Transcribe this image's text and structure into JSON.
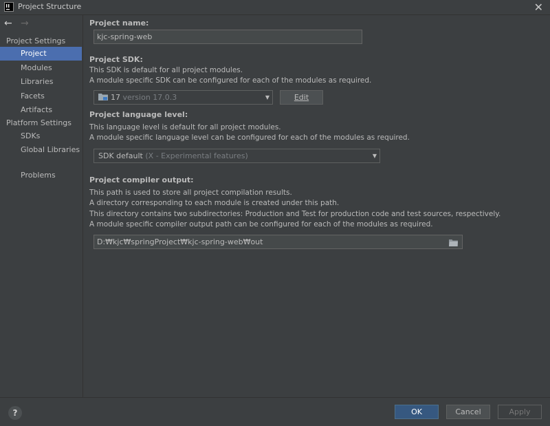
{
  "window": {
    "title": "Project Structure",
    "close_glyph": "✕"
  },
  "nav": {
    "back_glyph": "←",
    "forward_glyph": "→"
  },
  "sidebar": {
    "project_settings_header": "Project Settings",
    "project_settings_items": [
      {
        "label": "Project",
        "selected": true
      },
      {
        "label": "Modules"
      },
      {
        "label": "Libraries"
      },
      {
        "label": "Facets"
      },
      {
        "label": "Artifacts"
      }
    ],
    "platform_settings_header": "Platform Settings",
    "platform_settings_items": [
      {
        "label": "SDKs"
      },
      {
        "label": "Global Libraries"
      }
    ],
    "problems_label": "Problems"
  },
  "project": {
    "name_label": "Project name:",
    "name_value": "kjc-spring-web",
    "sdk_label": "Project SDK:",
    "sdk_desc_1": "This SDK is default for all project modules.",
    "sdk_desc_2": "A module specific SDK can be configured for each of the modules as required.",
    "sdk_value_main": "17",
    "sdk_value_dim": "version 17.0.3",
    "edit_button": "Edit",
    "lang_label": "Project language level:",
    "lang_desc_1": "This language level is default for all project modules.",
    "lang_desc_2": "A module specific language level can be configured for each of the modules as required.",
    "lang_value_main": "SDK default",
    "lang_value_dim": "(X - Experimental features)",
    "output_label": "Project compiler output:",
    "output_desc_1": "This path is used to store all project compilation results.",
    "output_desc_2": "A directory corresponding to each module is created under this path.",
    "output_desc_3": "This directory contains two subdirectories: Production and Test for production code and test sources, respectively.",
    "output_desc_4": "A module specific compiler output path can be configured for each of the modules as required.",
    "output_value": "D:₩kjc₩springProject₩kjc-spring-web₩out"
  },
  "footer": {
    "help_glyph": "?",
    "ok_button": "OK",
    "cancel_button": "Cancel",
    "apply_button": "Apply"
  },
  "colors": {
    "selection": "#4b6eaf",
    "ok_button": "#365880",
    "background": "#3c3f41"
  }
}
